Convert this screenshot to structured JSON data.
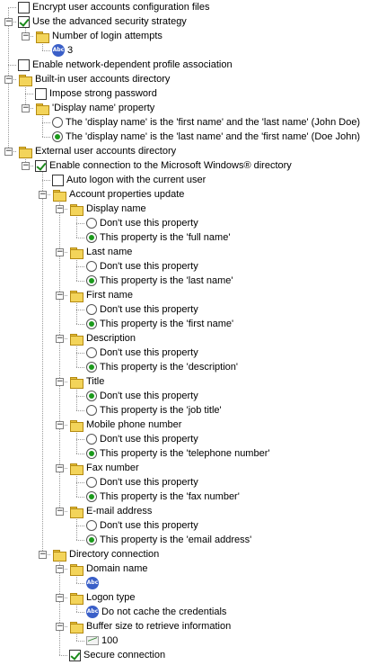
{
  "tree": {
    "encrypt_files": {
      "label": "Encrypt user accounts configuration files",
      "checked": false
    },
    "advanced_security": {
      "label": "Use the advanced security strategy",
      "checked": true
    },
    "login_attempts": {
      "label": "Number of login attempts",
      "value": "3"
    },
    "network_profile": {
      "label": "Enable network-dependent profile association",
      "checked": false
    },
    "builtin_directory": {
      "label": "Built-in user accounts directory"
    },
    "strong_password": {
      "label": "Impose strong password",
      "checked": false
    },
    "display_name_property": {
      "label": "'Display name' property"
    },
    "display_first_last": {
      "label": "The 'display name' is the 'first name' and the 'last name' (John Doe)",
      "selected": false
    },
    "display_last_first": {
      "label": "The 'display name' is the 'last name' and the 'first name' (Doe John)",
      "selected": true
    },
    "external_directory": {
      "label": "External user accounts directory"
    },
    "windows_directory": {
      "label": "Enable connection to the Microsoft Windows® directory",
      "checked": true
    },
    "auto_logon": {
      "label": "Auto logon with the current user",
      "checked": false
    },
    "account_update": {
      "label": "Account properties update"
    },
    "properties": [
      {
        "label": "Display name",
        "dont": "Don't use this property",
        "use": "This property is the 'full name'",
        "selected": "use"
      },
      {
        "label": "Last name",
        "dont": "Don't use this property",
        "use": "This property is the 'last name'",
        "selected": "use"
      },
      {
        "label": "First name",
        "dont": "Don't use this property",
        "use": "This property is the 'first name'",
        "selected": "use"
      },
      {
        "label": "Description",
        "dont": "Don't use this property",
        "use": "This property is the 'description'",
        "selected": "use"
      },
      {
        "label": "Title",
        "dont": "Don't use this property",
        "use": "This property is the 'job title'",
        "selected": "dont"
      },
      {
        "label": "Mobile phone number",
        "dont": "Don't use this property",
        "use": "This property is the 'telephone number'",
        "selected": "use"
      },
      {
        "label": "Fax number",
        "dont": "Don't use this property",
        "use": "This property is the 'fax number'",
        "selected": "use"
      },
      {
        "label": "E-mail address",
        "dont": "Don't use this property",
        "use": "This property is the 'email address'",
        "selected": "use"
      }
    ],
    "directory_connection": {
      "label": "Directory connection"
    },
    "domain_name": {
      "label": "Domain name",
      "value": ""
    },
    "logon_type": {
      "label": "Logon type",
      "value": "Do not cache the credentials"
    },
    "buffer_size": {
      "label": "Buffer size to retrieve information",
      "value": "100"
    },
    "secure_connection": {
      "label": "Secure connection",
      "checked": true
    }
  },
  "icons": {
    "folder": "folder-icon",
    "text_value": "abc-text-icon",
    "number_value": "number-value-icon"
  },
  "colors": {
    "folder": "#f3d45a",
    "check": "#1b8a1b",
    "radio": "#1b9a1b",
    "abc_badge": "#3a5fc8"
  }
}
